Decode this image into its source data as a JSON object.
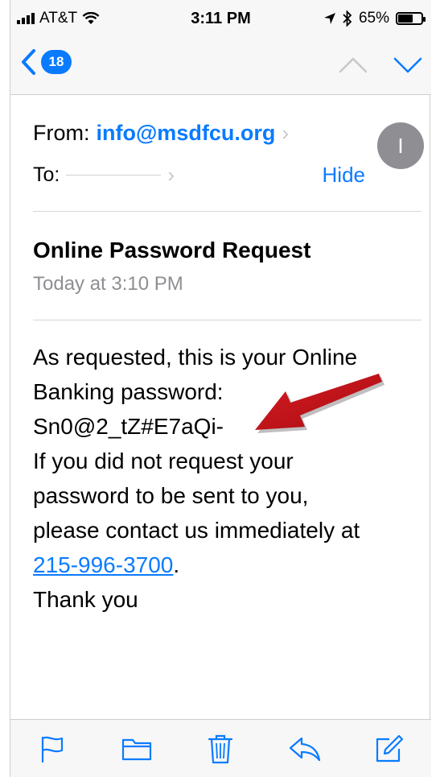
{
  "status_bar": {
    "carrier": "AT&T",
    "time": "3:11 PM",
    "battery": "65%",
    "battery_level": 0.65,
    "icons": [
      "signal-bars-icon",
      "wifi-icon",
      "location-arrow-icon",
      "bluetooth-icon",
      "battery-icon"
    ]
  },
  "nav": {
    "unread_count": "18",
    "icons": [
      "back-chevron-icon",
      "previous-message-icon",
      "next-message-icon"
    ]
  },
  "header": {
    "from_label": "From:",
    "from_address": "info@msdfcu.org",
    "to_label": "To:",
    "hide_label": "Hide",
    "avatar_initial": "I"
  },
  "message": {
    "subject": "Online Password Request",
    "date": "Today at 3:10 PM",
    "body_lines": [
      "As requested, this is your Online",
      "Banking password:",
      "Sn0@2_tZ#E7aQi-",
      "If you did not request your",
      "password to be sent to you,",
      "please contact us immediately at"
    ],
    "phone": "215-996-3700",
    "phone_suffix": ".",
    "closing": "Thank you"
  },
  "toolbar": {
    "icons": [
      "flag-icon",
      "folder-icon",
      "trash-icon",
      "reply-icon",
      "compose-icon"
    ]
  },
  "colors": {
    "accent": "#0a7bff",
    "annotation_arrow": "#c0141b",
    "avatar": "#8e8e93",
    "secondary_text": "#8e8e93"
  }
}
